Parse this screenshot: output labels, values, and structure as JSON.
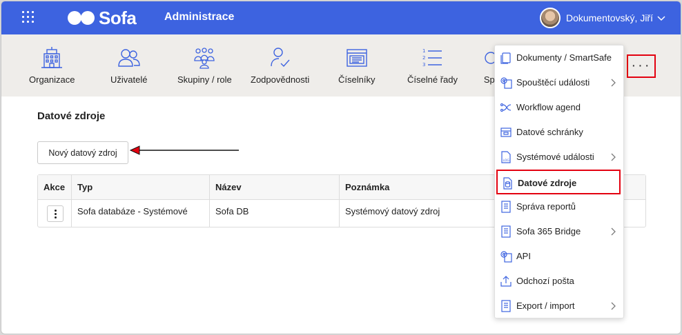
{
  "header": {
    "app_name": "Sofa",
    "section_title": "Administrace",
    "user_name": "Dokumentovský, Jiří"
  },
  "toolbar": {
    "items": [
      {
        "label": "Organizace",
        "icon": "building-icon"
      },
      {
        "label": "Uživatelé",
        "icon": "users-icon"
      },
      {
        "label": "Skupiny / role",
        "icon": "groups-icon"
      },
      {
        "label": "Zodpovědnosti",
        "icon": "user-check-icon"
      },
      {
        "label": "Číselníky",
        "icon": "list-window-icon"
      },
      {
        "label": "Číselné řady",
        "icon": "numbered-list-icon"
      },
      {
        "label": "Spr",
        "icon": "gear-icon"
      }
    ],
    "more_label": "···"
  },
  "main": {
    "title": "Datové zdroje",
    "new_button": "Nový datový zdroj",
    "table": {
      "columns": [
        "Akce",
        "Typ",
        "Název",
        "Poznámka"
      ],
      "rows": [
        {
          "typ": "Sofa databáze - Systémové",
          "nazev": "Sofa DB",
          "poznamka": "Systémový datový zdroj"
        }
      ]
    }
  },
  "menu": {
    "items": [
      {
        "label": "Dokumenty / SmartSafe",
        "icon": "document-icon",
        "submenu": false
      },
      {
        "label": "Spouštěcí události",
        "icon": "gear-document-icon",
        "submenu": true
      },
      {
        "label": "Workflow agend",
        "icon": "workflow-icon",
        "submenu": false
      },
      {
        "label": "Datové schránky",
        "icon": "mailbox-icon",
        "submenu": false
      },
      {
        "label": "Systémové události",
        "icon": "log-icon",
        "submenu": true
      },
      {
        "label": "Datové zdroje",
        "icon": "database-icon",
        "submenu": false,
        "active": true
      },
      {
        "label": "Správa reportů",
        "icon": "report-icon",
        "submenu": false
      },
      {
        "label": "Sofa 365 Bridge",
        "icon": "bridge-icon",
        "submenu": true
      },
      {
        "label": "API",
        "icon": "api-gear-icon",
        "submenu": false
      },
      {
        "label": "Odchozí pošta",
        "icon": "outbox-icon",
        "submenu": false
      },
      {
        "label": "Export / import",
        "icon": "export-icon",
        "submenu": true
      }
    ]
  },
  "colors": {
    "header_bg": "#3d63e0",
    "icon_blue": "#3d63e0",
    "highlight_red": "#e3000f"
  }
}
